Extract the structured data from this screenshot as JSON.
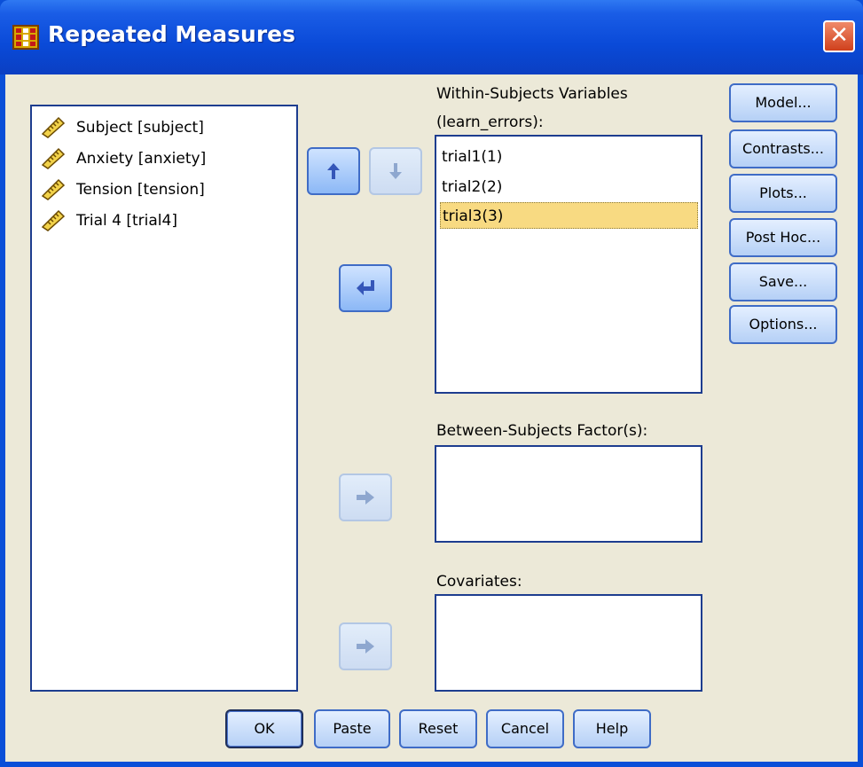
{
  "window": {
    "title": "Repeated Measures"
  },
  "source_variables": [
    {
      "label": "Subject [subject]",
      "icon": "ruler-icon"
    },
    {
      "label": "Anxiety [anxiety]",
      "icon": "ruler-icon"
    },
    {
      "label": "Tension [tension]",
      "icon": "ruler-icon"
    },
    {
      "label": "Trial 4 [trial4]",
      "icon": "ruler-icon"
    }
  ],
  "within_subjects": {
    "label_line1": "Within-Subjects Variables",
    "label_line2": "(learn_errors):",
    "items": [
      "trial1(1)",
      "trial2(2)",
      "trial3(3)"
    ],
    "selected_index": 2
  },
  "between_subjects": {
    "label": "Between-Subjects Factor(s):"
  },
  "covariates": {
    "label": "Covariates:"
  },
  "side_buttons": {
    "model": "Model...",
    "contrasts": "Contrasts...",
    "plots": "Plots...",
    "post_hoc": "Post Hoc...",
    "save": "Save...",
    "options": "Options..."
  },
  "bottom_buttons": {
    "ok": "OK",
    "paste": "Paste",
    "reset": "Reset",
    "cancel": "Cancel",
    "help": "Help"
  },
  "colors": {
    "title_bar": "#0a4ad8",
    "dialog_bg": "#ece9d8",
    "selection": "#f8da82",
    "button_border": "#3f6cc6"
  }
}
